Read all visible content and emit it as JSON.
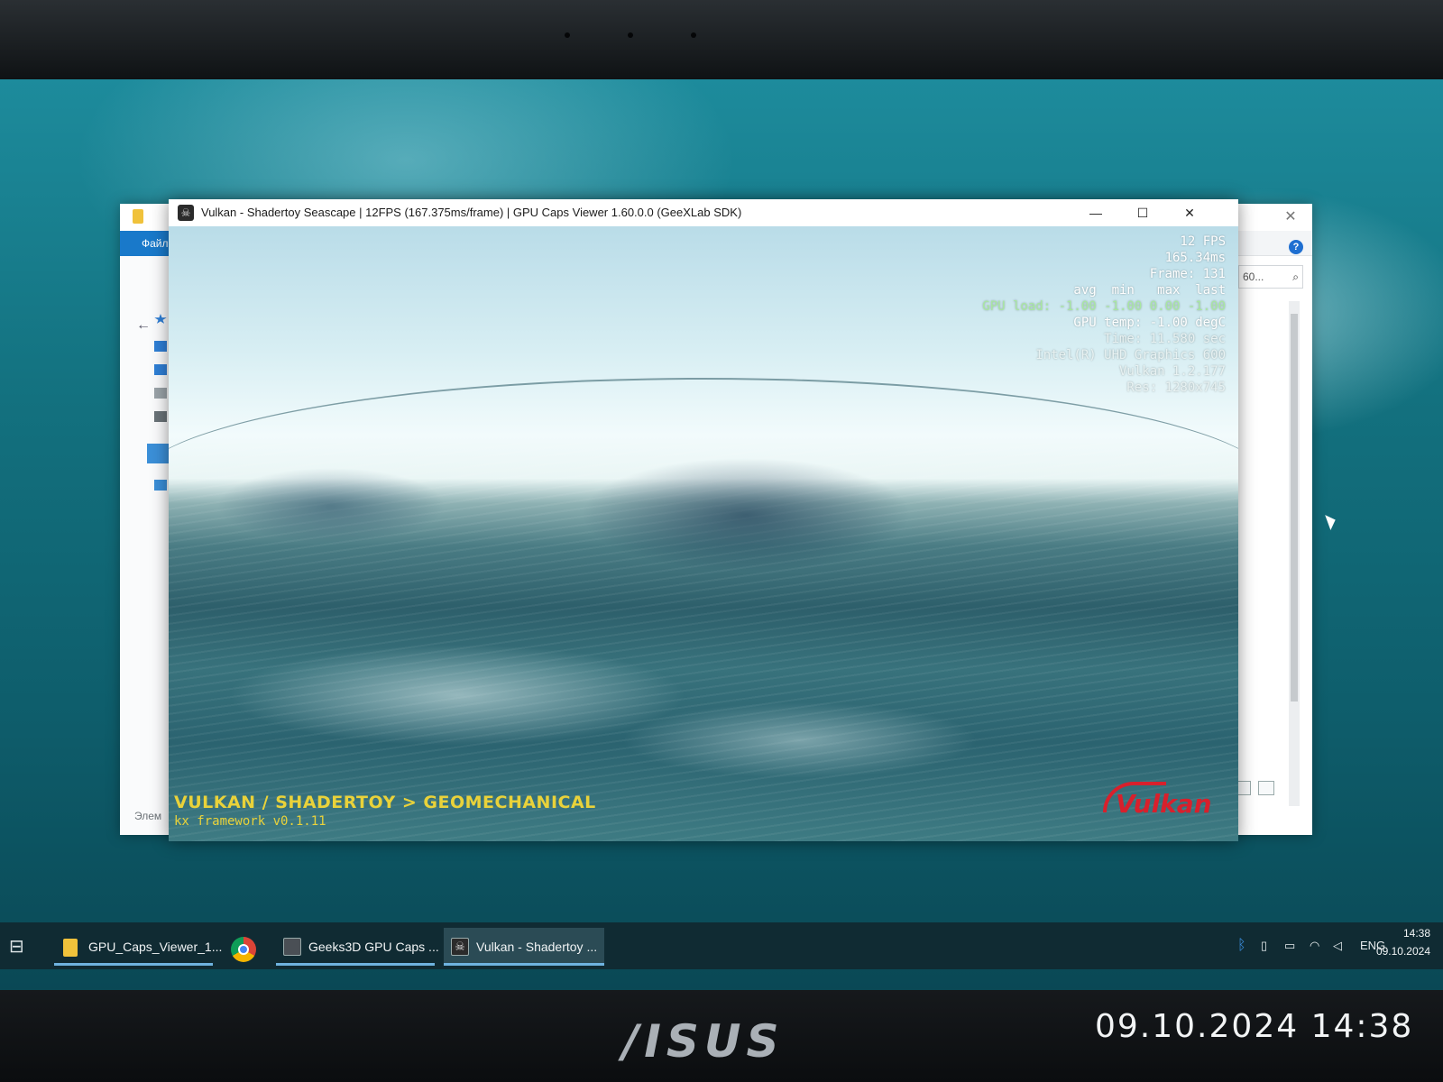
{
  "main_window": {
    "title": "Vulkan - Shadertoy Seascape | 12FPS (167.375ms/frame) | GPU Caps Viewer 1.60.0.0 (GeeXLab SDK)",
    "controls": {
      "minimize": "—",
      "maximize": "☐",
      "close": "✕"
    },
    "icon": "skull-app-icon"
  },
  "hud": {
    "fps": "12 FPS",
    "frame_time": "165.34ms",
    "frame": "Frame: 131",
    "stats_header": "avg  min   max  last",
    "gpu_load": "GPU load: -1.00 -1.00 0.00 -1.00",
    "gpu_temp": "GPU temp: -1.00 degC",
    "time": "Time: 11.580 sec",
    "gpu_name": "Intel(R) UHD Graphics 600",
    "api": "Vulkan 1.2.177",
    "res": "Res: 1280x745"
  },
  "banner": {
    "title": "VULKAN / SHADERTOY > GEOMECHANICAL",
    "subtitle": "kx framework v0.1.11",
    "logo": "Vulkan"
  },
  "explorer": {
    "file_tab": "Файл",
    "search_text": "60...",
    "status_text": "Элем",
    "help": "?"
  },
  "taskbar": {
    "items": [
      {
        "label": "GPU_Caps_Viewer_1...",
        "icon": "folder-icon"
      },
      {
        "label": "",
        "icon": "chrome-icon"
      },
      {
        "label": "Geeks3D GPU Caps ...",
        "icon": "gpu-caps-icon"
      },
      {
        "label": "Vulkan - Shadertoy ...",
        "icon": "skull-app-icon"
      }
    ],
    "tray": {
      "lang": "ENG",
      "time": "14:38",
      "date": "09.10.2024"
    }
  },
  "photo": {
    "brand": "/ISUS",
    "timestamp": "09.10.2024 14:38"
  }
}
